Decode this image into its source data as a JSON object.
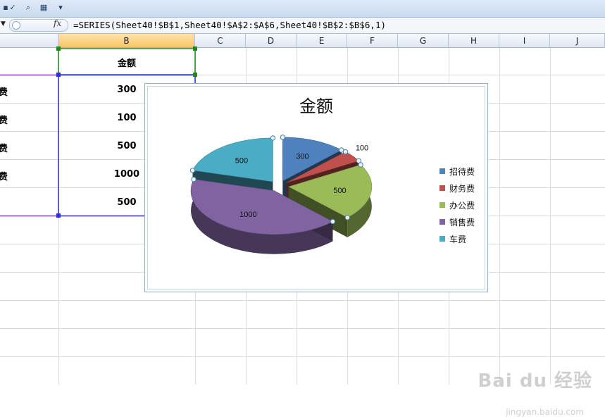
{
  "toolbar": {
    "icons": [
      "save-icon",
      "spellcheck-icon",
      "print-preview-icon",
      "borders-icon",
      "qat-dropdown-icon"
    ]
  },
  "formula_bar": {
    "fx_label": "fx",
    "formula": "=SERIES(Sheet40!$B$1,Sheet40!$A$2:$A$6,Sheet40!$B$2:$B$6,1)"
  },
  "columns": [
    "B",
    "C",
    "D",
    "E",
    "F",
    "G",
    "H",
    "I",
    "J"
  ],
  "sheet": {
    "header_b": "金额",
    "row_labels": [
      "费",
      "费",
      "费",
      "费"
    ],
    "values": [
      "300",
      "100",
      "500",
      "1000",
      "500"
    ]
  },
  "chart_data": {
    "type": "pie",
    "title": "金额",
    "categories": [
      "招待费",
      "财务费",
      "办公费",
      "销售费",
      "车费"
    ],
    "values": [
      300,
      100,
      500,
      1000,
      500
    ],
    "data_labels": [
      "300",
      "100",
      "500",
      "1000",
      "500"
    ],
    "colors": [
      "#4f81bd",
      "#c0504d",
      "#9bbb59",
      "#8064a2",
      "#4bacc6"
    ],
    "legend_position": "right",
    "exploded": true,
    "three_d": true
  },
  "watermark": {
    "text": "Bai du 经验",
    "sub": "jingyan.baidu.com"
  }
}
